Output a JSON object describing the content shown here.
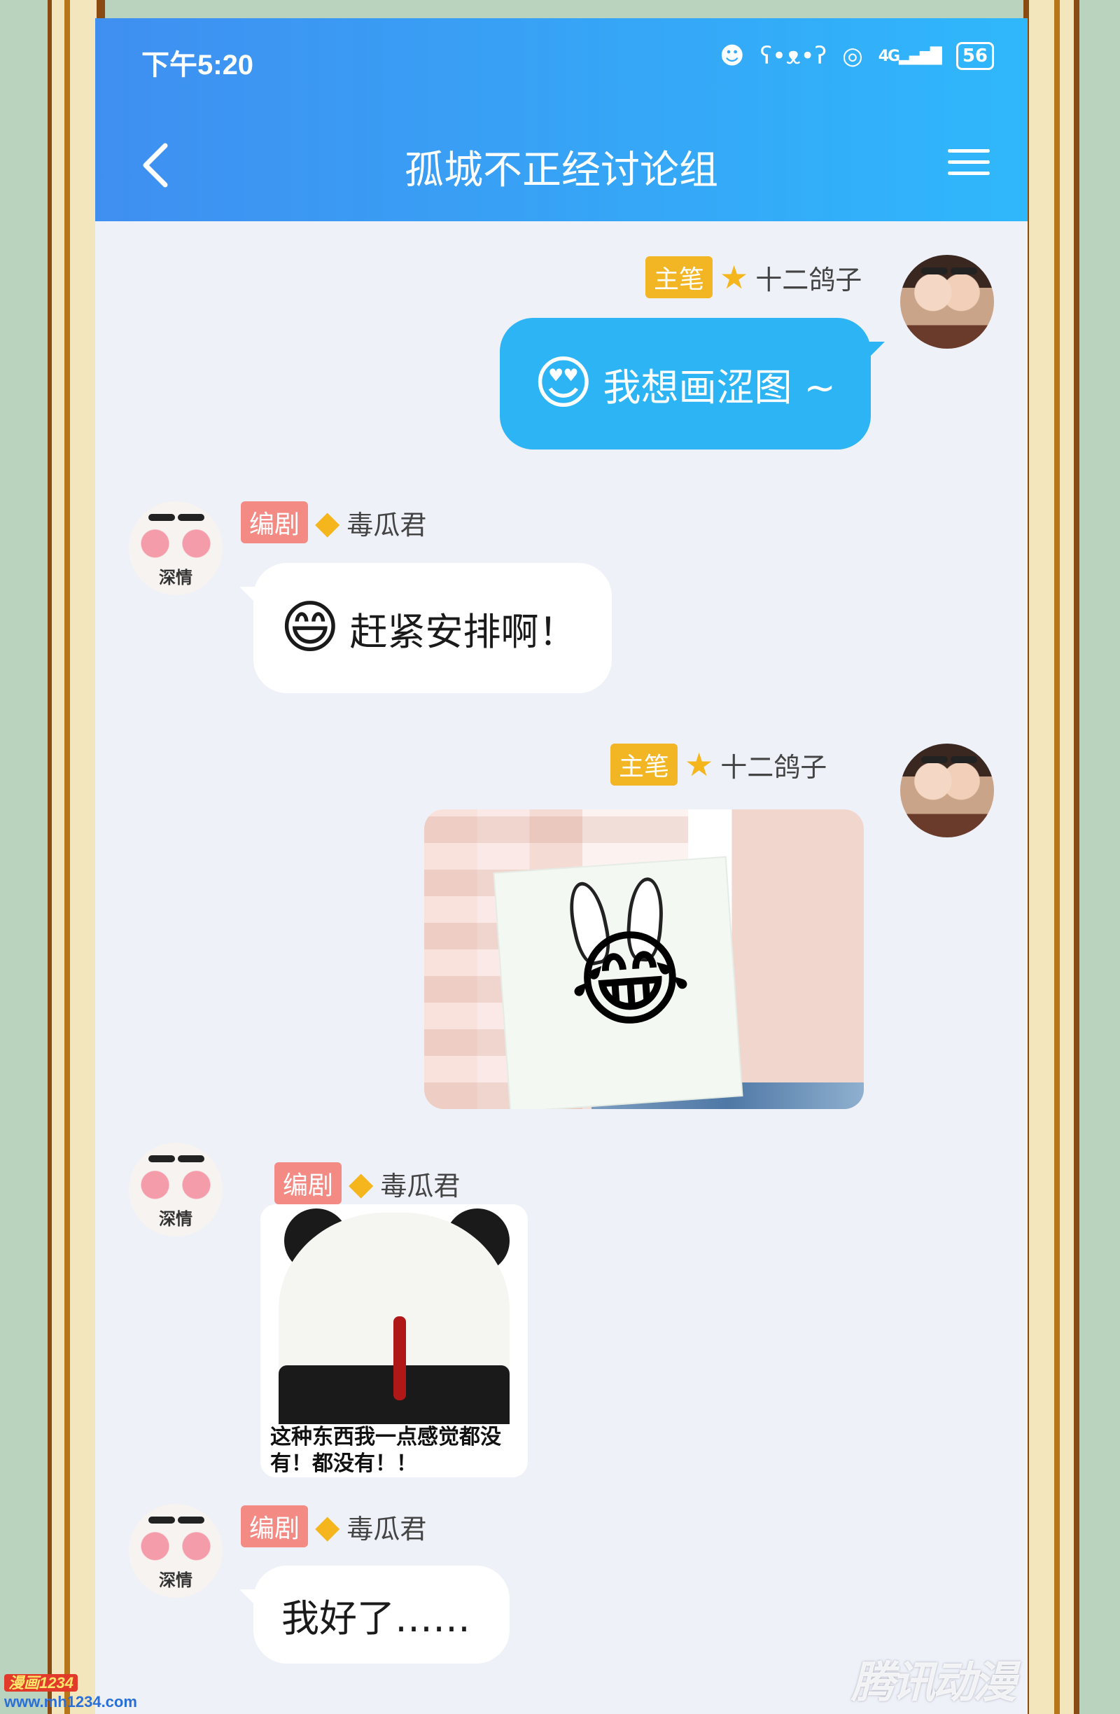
{
  "status": {
    "time": "下午5:20",
    "network": "4G",
    "battery": "56"
  },
  "header": {
    "title": "孤城不正经讨论组"
  },
  "messages": [
    {
      "side": "right",
      "role": "主笔",
      "sender": "十二鸽子",
      "emoji": "😍",
      "text": "我想画涩图 ~"
    },
    {
      "side": "left",
      "role": "编剧",
      "sender": "毒瓜君",
      "avatar_caption": "深情",
      "emoji": "😄",
      "text": "赶紧安排啊！"
    },
    {
      "side": "right",
      "role": "主笔",
      "sender": "十二鸽子",
      "type": "image",
      "emoji": "😂"
    },
    {
      "side": "left",
      "role": "编剧",
      "sender": "毒瓜君",
      "avatar_caption": "深情",
      "type": "sticker",
      "caption": "这种东西我一点感觉都没有！都没有！！"
    },
    {
      "side": "left",
      "role": "编剧",
      "sender": "毒瓜君",
      "avatar_caption": "深情",
      "text": "我好了……"
    }
  ],
  "watermarks": {
    "left_top": "漫画1234",
    "left_bottom": "www.mh1234.com",
    "right": "腾讯动漫"
  },
  "colors": {
    "header_start": "#3f8ff0",
    "header_end": "#2fb7fb",
    "bubble_blue": "#2db4f5",
    "tag_gold": "#f2b523",
    "tag_red": "#f38a84"
  }
}
